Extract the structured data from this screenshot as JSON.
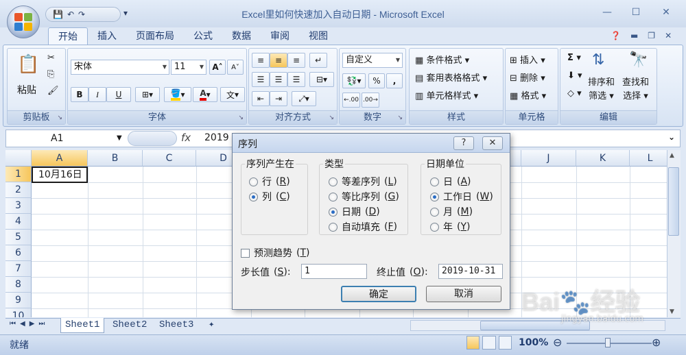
{
  "window": {
    "title": "Excel里如何快速加入自动日期 - Microsoft Excel",
    "minimize": "—",
    "restore": "☐",
    "close": "✕"
  },
  "qat": {
    "save": "💾",
    "undo": "↶",
    "redo": "↷",
    "more": "▾"
  },
  "tabs": [
    "开始",
    "插入",
    "页面布局",
    "公式",
    "数据",
    "审阅",
    "视图"
  ],
  "ribbon": {
    "clipboard": {
      "label": "剪贴板",
      "paste": "粘贴"
    },
    "font": {
      "label": "字体",
      "name": "宋体",
      "size": "11",
      "bold": "B",
      "italic": "I",
      "underline": "U",
      "grow": "A",
      "shrink": "A",
      "font_color": "A",
      "phonetic": "文"
    },
    "alignment": {
      "label": "对齐方式"
    },
    "number": {
      "label": "数字",
      "format": "自定义",
      "percent": "%",
      "comma": ",",
      "inc_dec": ".00",
      "dec_dec": ".00"
    },
    "styles": {
      "label": "样式",
      "conditional": "条件格式",
      "table": "套用表格格式",
      "cell": "单元格样式"
    },
    "cells": {
      "label": "单元格",
      "insert": "插入",
      "delete": "删除",
      "format": "格式"
    },
    "editing": {
      "label": "编辑",
      "sigma": "Σ",
      "sort_l1": "排序和",
      "sort_l2": "筛选",
      "find_l1": "查找和",
      "find_l2": "选择"
    }
  },
  "formula_bar": {
    "name_box": "A1",
    "fx": "fx",
    "value": "2019"
  },
  "grid": {
    "columns": [
      "A",
      "B",
      "C",
      "D",
      "E",
      "F",
      "G",
      "H",
      "I",
      "J",
      "K",
      "L"
    ],
    "rows": [
      "1",
      "2",
      "3",
      "4",
      "5",
      "6",
      "7",
      "8",
      "9",
      "10"
    ],
    "a1_value": "10月16日"
  },
  "sheets": [
    "Sheet1",
    "Sheet2",
    "Sheet3"
  ],
  "status": {
    "text": "就绪",
    "zoom": "100%"
  },
  "dialog": {
    "title": "序列",
    "help": "?",
    "close": "✕",
    "series_in": {
      "legend": "序列产生在",
      "rows": "行",
      "rows_key": "R",
      "cols": "列",
      "cols_key": "C"
    },
    "type": {
      "legend": "类型",
      "linear": "等差序列",
      "linear_key": "L",
      "growth": "等比序列",
      "growth_key": "G",
      "date": "日期",
      "date_key": "D",
      "autofill": "自动填充",
      "autofill_key": "F"
    },
    "date_unit": {
      "legend": "日期单位",
      "day": "日",
      "day_key": "A",
      "weekday": "工作日",
      "weekday_key": "W",
      "month": "月",
      "month_key": "M",
      "year": "年",
      "year_key": "Y"
    },
    "trend": {
      "label": "预测趋势",
      "key": "T"
    },
    "step": {
      "label": "步长值",
      "key": "S",
      "value": "1"
    },
    "stop": {
      "label": "终止值",
      "key": "O",
      "value": "2019-10-31"
    },
    "ok": "确定",
    "cancel": "取消"
  },
  "watermark": "jingyan.baidu.com"
}
